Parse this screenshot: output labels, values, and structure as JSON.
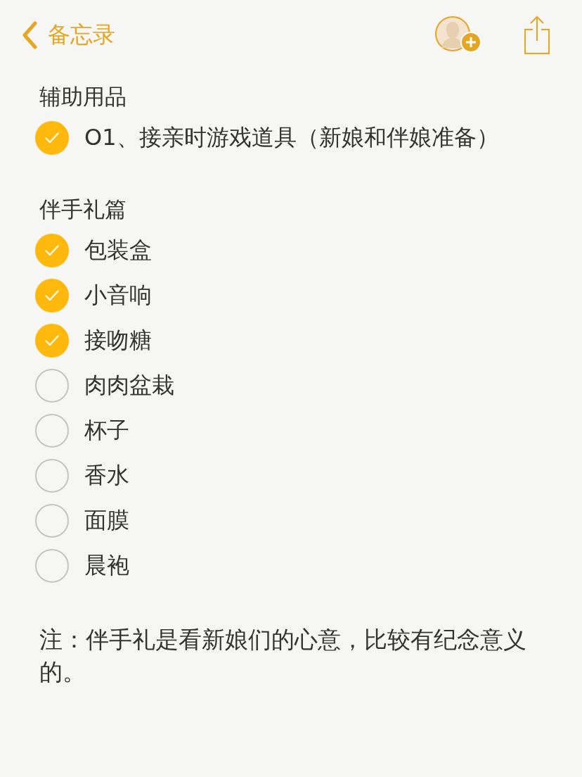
{
  "nav": {
    "back_label": "备忘录"
  },
  "sections": [
    {
      "heading": "辅助用品",
      "items": [
        {
          "text": "O1、接亲时游戏道具（新娘和伴娘准备）",
          "checked": true
        }
      ]
    },
    {
      "heading": "伴手礼篇",
      "items": [
        {
          "text": "包装盒",
          "checked": true
        },
        {
          "text": "小音响",
          "checked": true
        },
        {
          "text": "接吻糖",
          "checked": true
        },
        {
          "text": "肉肉盆栽",
          "checked": false
        },
        {
          "text": "杯子",
          "checked": false
        },
        {
          "text": "香水",
          "checked": false
        },
        {
          "text": "面膜",
          "checked": false
        },
        {
          "text": "晨袍",
          "checked": false
        }
      ]
    }
  ],
  "note": "注：伴手礼是看新娘们的心意，比较有纪念意义的。"
}
